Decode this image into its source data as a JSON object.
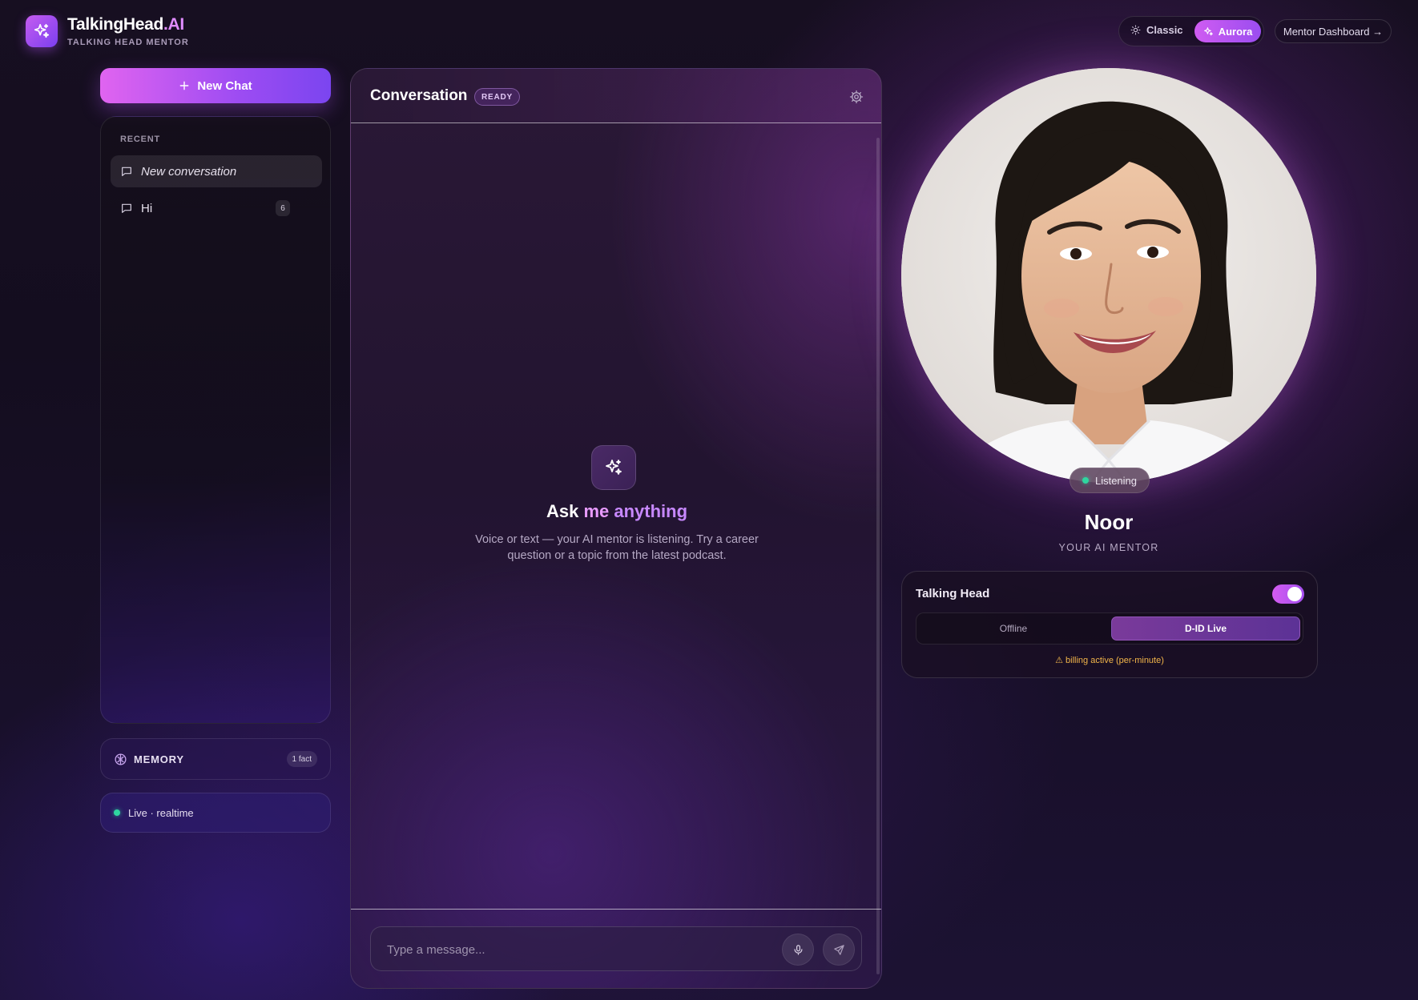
{
  "brand": {
    "name_main": "TalkingHead",
    "name_suffix": ".AI",
    "subtitle": "TALKING HEAD MENTOR",
    "logo_icon": "sparkles-icon"
  },
  "header": {
    "theme_classic": "Classic",
    "theme_aurora": "Aurora",
    "active_theme": "Aurora",
    "mentor_dashboard": "Mentor Dashboard →"
  },
  "sidebar": {
    "new_chat": "New Chat",
    "recent_label": "RECENT",
    "conversations": [
      {
        "title": "New conversation",
        "active": true,
        "count": ""
      },
      {
        "title": "Hi",
        "active": false,
        "count": "6"
      }
    ],
    "memory_label": "MEMORY",
    "memory_count": "1 fact",
    "live_status": "Live · realtime"
  },
  "conversation": {
    "title": "Conversation",
    "status": "READY",
    "empty_title_ask": "Ask",
    "empty_title_me": "me",
    "empty_title_anything": "anything",
    "empty_desc": "Voice or text — your AI mentor is listening. Try a career question or a topic from the latest podcast.",
    "input_placeholder": "Type a message..."
  },
  "mentor": {
    "status": "Listening",
    "name": "Noor",
    "role": "YOUR AI MENTOR",
    "talking_head_label": "Talking Head",
    "talking_head_enabled": true,
    "mode_offline": "Offline",
    "mode_live": "D-ID Live",
    "active_mode": "D-ID Live",
    "billing_note": "⚠ billing active (per-minute)"
  },
  "colors": {
    "accent": "#c55cf0",
    "accent_secondary": "#7b45f0",
    "live_dot": "#2fd6a0",
    "warning": "#f2b54a"
  }
}
